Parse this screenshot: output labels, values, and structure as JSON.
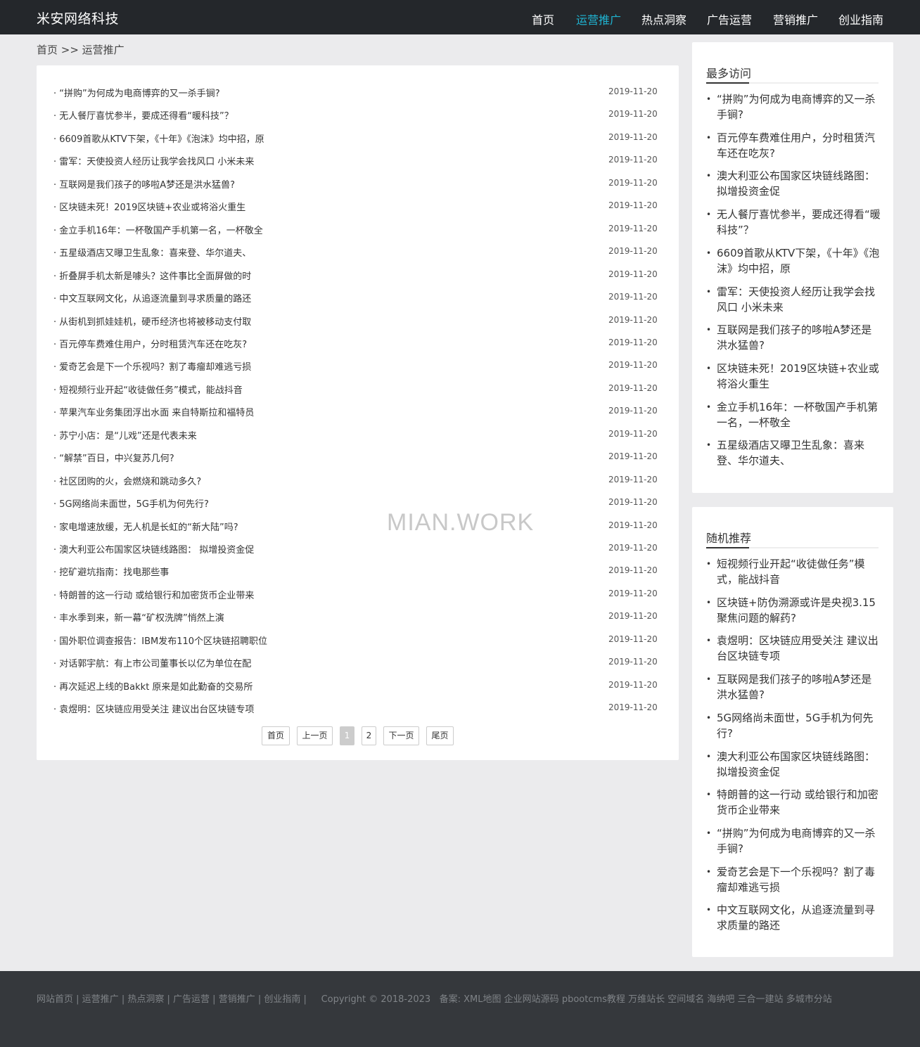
{
  "header": {
    "brand": "米安网络科技",
    "nav": [
      "首页",
      "运营推广",
      "热点洞察",
      "广告运营",
      "营销推广",
      "创业指南"
    ],
    "active_index": 1,
    "accent_color": "#1fb3d1"
  },
  "breadcrumb": "首页 >> 运营推广",
  "list": [
    {
      "title": "· “拼购”为何成为电商博弈的又一杀手锏?",
      "date": "2019-11-20"
    },
    {
      "title": "· 无人餐厅喜忧参半，要成还得看“暖科技”？",
      "date": "2019-11-20"
    },
    {
      "title": "· 6609首歌从KTV下架，《十年》《泡沫》均中招，原",
      "date": "2019-11-20"
    },
    {
      "title": "· 雷军：天使投资人经历让我学会找风口 小米未来",
      "date": "2019-11-20"
    },
    {
      "title": "· 互联网是我们孩子的哆啦A梦还是洪水猛兽?",
      "date": "2019-11-20"
    },
    {
      "title": "· 区块链未死！2019区块链+农业或将浴火重生",
      "date": "2019-11-20"
    },
    {
      "title": "· 金立手机16年：一杯敬国产手机第一名，一杯敬全",
      "date": "2019-11-20"
    },
    {
      "title": "· 五星级酒店又曝卫生乱象：喜来登、华尔道夫、",
      "date": "2019-11-20"
    },
    {
      "title": "· 折叠屏手机太新是噱头？这件事比全面屏做的时",
      "date": "2019-11-20"
    },
    {
      "title": "· 中文互联网文化，从追逐流量到寻求质量的路还",
      "date": "2019-11-20"
    },
    {
      "title": "· 从街机到抓娃娃机，硬币经济也将被移动支付取",
      "date": "2019-11-20"
    },
    {
      "title": "· 百元停车费难住用户，分时租赁汽车还在吃灰?",
      "date": "2019-11-20"
    },
    {
      "title": "· 爱奇艺会是下一个乐视吗？割了毒瘤却难逃亏损",
      "date": "2019-11-20"
    },
    {
      "title": "· 短视频行业开起“收徒做任务”模式，能战抖音",
      "date": "2019-11-20"
    },
    {
      "title": "· 苹果汽车业务集团浮出水面 来自特斯拉和福特员",
      "date": "2019-11-20"
    },
    {
      "title": "· 苏宁小店：是“儿戏”还是代表未来",
      "date": "2019-11-20"
    },
    {
      "title": "· “解禁”百日，中兴复苏几何?",
      "date": "2019-11-20"
    },
    {
      "title": "· 社区团购的火，会燃烧和跳动多久?",
      "date": "2019-11-20"
    },
    {
      "title": "· 5G网络尚未面世，5G手机为何先行?",
      "date": "2019-11-20"
    },
    {
      "title": "· 家电增速放缓，无人机是长虹的“新大陆”吗?",
      "date": "2019-11-20"
    },
    {
      "title": "· 澳大利亚公布国家区块链线路图： 拟增投资金促",
      "date": "2019-11-20"
    },
    {
      "title": "· 挖矿避坑指南：找电那些事",
      "date": "2019-11-20"
    },
    {
      "title": "· 特朗普的这一行动 或给银行和加密货币企业带来",
      "date": "2019-11-20"
    },
    {
      "title": "· 丰水季到来，新一幕“矿权洗牌”悄然上演",
      "date": "2019-11-20"
    },
    {
      "title": "· 国外职位调查报告：IBM发布110个区块链招聘职位",
      "date": "2019-11-20"
    },
    {
      "title": "· 对话郭宇航：有上市公司董事长以亿为单位在配",
      "date": "2019-11-20"
    },
    {
      "title": "· 再次延迟上线的Bakkt 原来是如此勤奋的交易所",
      "date": "2019-11-20"
    },
    {
      "title": "· 袁煜明：区块链应用受关注 建议出台区块链专项",
      "date": "2019-11-20"
    }
  ],
  "pager": {
    "first": "首页",
    "prev": "上一页",
    "pages": [
      "1",
      "2"
    ],
    "current": "1",
    "next": "下一页",
    "last": "尾页"
  },
  "watermark": "MIAN.WORK",
  "sidebar": {
    "most_visited": {
      "title": "最多访问",
      "items": [
        "“拼购”为何成为电商博弈的又一杀手锏?",
        "百元停车费难住用户，分时租赁汽车还在吃灰?",
        "澳大利亚公布国家区块链线路图：拟增投资金促",
        "无人餐厅喜忧参半，要成还得看“暖科技”？",
        "6609首歌从KTV下架，《十年》《泡沫》均中招，原",
        "雷军：天使投资人经历让我学会找风口 小米未来",
        "互联网是我们孩子的哆啦A梦还是洪水猛兽?",
        "区块链未死！2019区块链+农业或将浴火重生",
        "金立手机16年：一杯敬国产手机第一名，一杯敬全",
        "五星级酒店又曝卫生乱象：喜来登、华尔道夫、"
      ]
    },
    "recommended": {
      "title": "随机推荐",
      "items": [
        "短视频行业开起“收徒做任务”模式，能战抖音",
        "区块链+防伪溯源或许是央视3.15聚焦问题的解药?",
        "袁煜明：区块链应用受关注 建议出台区块链专项",
        "互联网是我们孩子的哆啦A梦还是洪水猛兽?",
        "5G网络尚未面世，5G手机为何先行?",
        "澳大利亚公布国家区块链线路图：拟增投资金促",
        "特朗普的这一行动 或给银行和加密货币企业带来",
        "“拼购”为何成为电商博弈的又一杀手锏?",
        "爱奇艺会是下一个乐视吗？割了毒瘤却难逃亏损",
        "中文互联网文化，从追逐流量到寻求质量的路还"
      ]
    }
  },
  "footer": {
    "links": [
      "网站首页",
      "运营推广",
      "热点洞察",
      "广告运营",
      "营销推广",
      "创业指南"
    ],
    "copyright": "Copyright © 2018-2023",
    "record_label": "备案:",
    "extra_links": [
      "XML地图",
      "企业网站源码",
      "pbootcms教程",
      "万维站长",
      "空间域名",
      "海纳吧",
      "三合一建站",
      "多城市分站"
    ]
  }
}
